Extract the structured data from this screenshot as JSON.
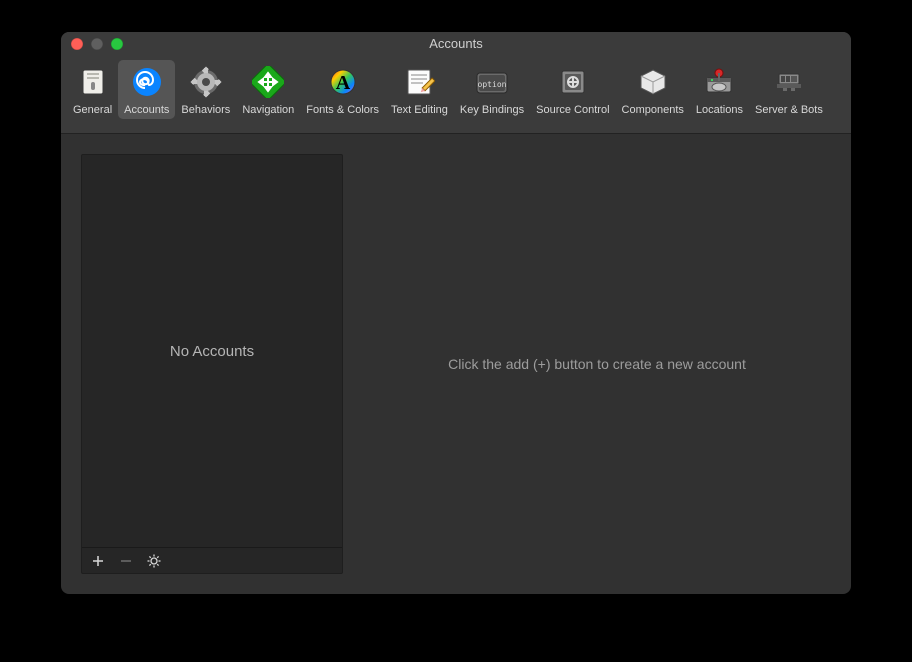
{
  "window": {
    "title": "Accounts"
  },
  "toolbar": {
    "tabs": [
      {
        "id": "general",
        "label": "General"
      },
      {
        "id": "accounts",
        "label": "Accounts"
      },
      {
        "id": "behaviors",
        "label": "Behaviors"
      },
      {
        "id": "navigation",
        "label": "Navigation"
      },
      {
        "id": "fonts-colors",
        "label": "Fonts & Colors"
      },
      {
        "id": "text-editing",
        "label": "Text Editing"
      },
      {
        "id": "key-bindings",
        "label": "Key Bindings"
      },
      {
        "id": "source-control",
        "label": "Source Control"
      },
      {
        "id": "components",
        "label": "Components"
      },
      {
        "id": "locations",
        "label": "Locations"
      },
      {
        "id": "server-bots",
        "label": "Server & Bots"
      }
    ],
    "selected": "accounts"
  },
  "sidebar": {
    "empty_label": "No Accounts"
  },
  "main": {
    "hint": "Click the add (+) button to create a new account"
  }
}
